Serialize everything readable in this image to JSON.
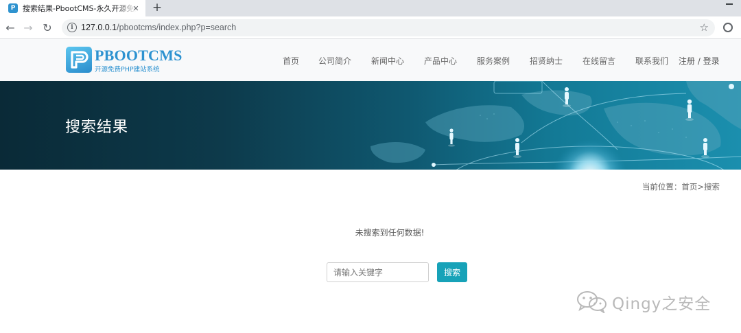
{
  "browser": {
    "tab_title": "搜索结果-PbootCMS-永久开源免费PHP建站系统",
    "favicon_letter": "P",
    "close_glyph": "✕",
    "new_tab_glyph": "+",
    "url_host": "127.0.0.1",
    "url_path": "/pbootcms/index.php?p=search",
    "back_glyph": "←",
    "forward_glyph": "→",
    "reload_glyph": "↻",
    "info_glyph": "i",
    "star_glyph": "☆"
  },
  "site": {
    "logo_text": "PBOOTCMS",
    "logo_subtitle": "开源免费PHP建站系统",
    "nav": [
      {
        "label": "首页"
      },
      {
        "label": "公司简介"
      },
      {
        "label": "新闻中心"
      },
      {
        "label": "产品中心"
      },
      {
        "label": "服务案例"
      },
      {
        "label": "招贤纳士"
      },
      {
        "label": "在线留言"
      },
      {
        "label": "联系我们"
      }
    ],
    "user_link": "注册 / 登录"
  },
  "banner": {
    "title": "搜索结果"
  },
  "breadcrumb": {
    "prefix": "当前位置：",
    "home": "首页",
    "separator": ">",
    "current": "搜索"
  },
  "content": {
    "no_result": "未搜索到任何数据!",
    "search_placeholder": "请输入关键字",
    "search_button": "搜索"
  },
  "watermark": {
    "text": "Qingy之安全"
  },
  "colors": {
    "accent": "#17a2b8",
    "logo_blue": "#2d92d0",
    "banner_dark": "#0a2a37",
    "banner_light": "#1b8fae"
  }
}
